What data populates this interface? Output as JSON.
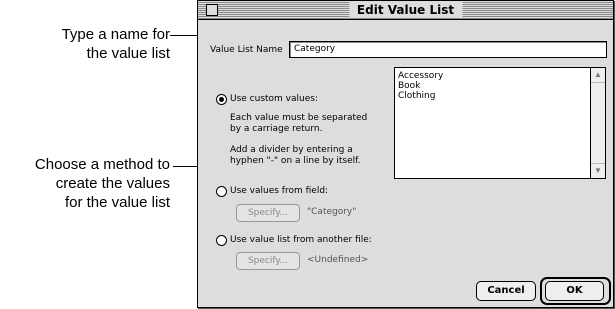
{
  "callouts": {
    "name_line1": "Type a name for",
    "name_line2": "the value list",
    "method_line1": "Choose a method to",
    "method_line2": "create the values",
    "method_line3": "for the value list"
  },
  "dialog": {
    "title": "Edit Value List",
    "name_label": "Value List Name",
    "name_value": "Category",
    "values_list": [
      "Accessory",
      "Book",
      "Clothing"
    ],
    "option_custom": {
      "label": "Use custom values:",
      "help1": "Each value must be separated",
      "help2": "by a carriage return.",
      "help3": "Add a divider by entering a",
      "help4": "hyphen \"-\" on a line by itself.",
      "selected": true
    },
    "option_field": {
      "label": "Use values from field:",
      "specify": "Specify...",
      "value": "\"Category\"",
      "selected": false
    },
    "option_file": {
      "label": "Use value list from another file:",
      "specify": "Specify...",
      "value": "<Undefined>",
      "selected": false
    },
    "cancel_label": "Cancel",
    "ok_label": "OK"
  }
}
